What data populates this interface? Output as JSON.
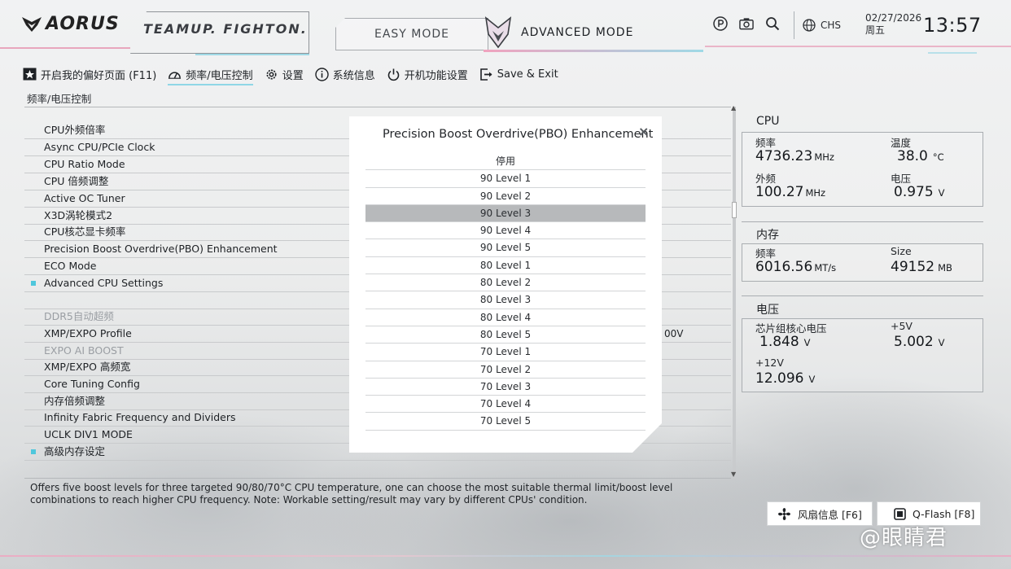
{
  "header": {
    "brand": "AORUS",
    "team_text": "TEAMUP. FIGHTON.",
    "mode_easy": "EASY MODE",
    "mode_advanced": "ADVANCED MODE",
    "icons": [
      "help-icon",
      "camera-icon",
      "search-icon",
      "globe-icon"
    ],
    "language": "CHS",
    "date": "02/27/2026",
    "weekday": "周五",
    "time": "13:57"
  },
  "nav": {
    "items": [
      {
        "label": "开启我的偏好页面 (F11)",
        "icon": "star-icon"
      },
      {
        "label": "频率/电压控制",
        "icon": "gauge-icon"
      },
      {
        "label": "设置",
        "icon": "gear-icon"
      },
      {
        "label": "系统信息",
        "icon": "info-icon"
      },
      {
        "label": "开机功能设置",
        "icon": "power-icon"
      },
      {
        "label": "Save & Exit",
        "icon": "exit-icon"
      }
    ]
  },
  "breadcrumb": "频率/电压控制",
  "settings": [
    {
      "label": "CPU外频倍率",
      "dim": false,
      "dot": false
    },
    {
      "label": "Async CPU/PCIe Clock",
      "dim": false,
      "dot": false
    },
    {
      "label": "CPU Ratio Mode",
      "dim": false,
      "dot": false
    },
    {
      "label": "CPU 倍频调整",
      "dim": false,
      "dot": false
    },
    {
      "label": "Active OC Tuner",
      "dim": false,
      "dot": false
    },
    {
      "label": "X3D涡轮模式2",
      "dim": false,
      "dot": false
    },
    {
      "label": "CPU核芯显卡频率",
      "dim": false,
      "dot": false
    },
    {
      "label": "Precision Boost Overdrive(PBO) Enhancement",
      "dim": false,
      "dot": false
    },
    {
      "label": "ECO Mode",
      "dim": false,
      "dot": false
    },
    {
      "label": "Advanced CPU Settings",
      "dim": false,
      "dot": true
    },
    {
      "label": "",
      "dim": false,
      "dot": false
    },
    {
      "label": "DDR5自动超频",
      "dim": true,
      "dot": false
    },
    {
      "label": "XMP/EXPO Profile",
      "dim": false,
      "dot": false,
      "value": "00V"
    },
    {
      "label": "EXPO AI BOOST",
      "dim": true,
      "dot": false
    },
    {
      "label": "XMP/EXPO 高频宽",
      "dim": false,
      "dot": false
    },
    {
      "label": "Core Tuning Config",
      "dim": false,
      "dot": false
    },
    {
      "label": "内存倍频调整",
      "dim": false,
      "dot": false
    },
    {
      "label": "Infinity Fabric Frequency and Dividers",
      "dim": false,
      "dot": false
    },
    {
      "label": "UCLK DIV1 MODE",
      "dim": false,
      "dot": false
    },
    {
      "label": "高级内存设定",
      "dim": false,
      "dot": true
    }
  ],
  "help_text": "Offers five boost levels for three targeted 90/80/70°C CPU temperature, one can choose the most suitable thermal limit/boost level combinations to reach higher CPU frequency. Note: Workable setting/result may vary by different CPUs' condition.",
  "modal": {
    "title": "Precision Boost Overdrive(PBO) Enhancement",
    "close": "×",
    "selected_index": 3,
    "options": [
      "停用",
      "90 Level 1",
      "90 Level 2",
      "90 Level 3",
      "90 Level 4",
      "90 Level 5",
      "80 Level 1",
      "80 Level 2",
      "80 Level 3",
      "80 Level 4",
      "80 Level 5",
      "70 Level 1",
      "70 Level 2",
      "70 Level 3",
      "70 Level 4",
      "70 Level 5"
    ]
  },
  "status": {
    "cpu": {
      "title": "CPU",
      "freq_label": "频率",
      "freq_value": "4736.23",
      "freq_unit": "MHz",
      "temp_label": "温度",
      "temp_value": "38.0",
      "temp_unit": "°C",
      "bclk_label": "外频",
      "bclk_value": "100.27",
      "bclk_unit": "MHz",
      "volt_label": "电压",
      "volt_value": "0.975",
      "volt_unit": "V"
    },
    "memory": {
      "title": "内存",
      "freq_label": "频率",
      "freq_value": "6016.56",
      "freq_unit": "MT/s",
      "size_label": "Size",
      "size_value": "49152",
      "size_unit": "MB"
    },
    "voltage": {
      "title": "电压",
      "chipset_label": "芯片组核心电压",
      "chipset_value": "1.848",
      "chipset_unit": "V",
      "v5_label": "+5V",
      "v5_value": "5.002",
      "v5_unit": "V",
      "v12_label": "+12V",
      "v12_value": "12.096",
      "v12_unit": "V"
    }
  },
  "buttons": {
    "fan": "风扇信息 [F6]",
    "qflash": "Q-Flash [F8]"
  },
  "watermark": "@眼睛君",
  "colors": {
    "accent_cyan": "#4fc7dc",
    "accent_pink": "#f0a3bf",
    "selected_row": "#b7b9bb"
  }
}
